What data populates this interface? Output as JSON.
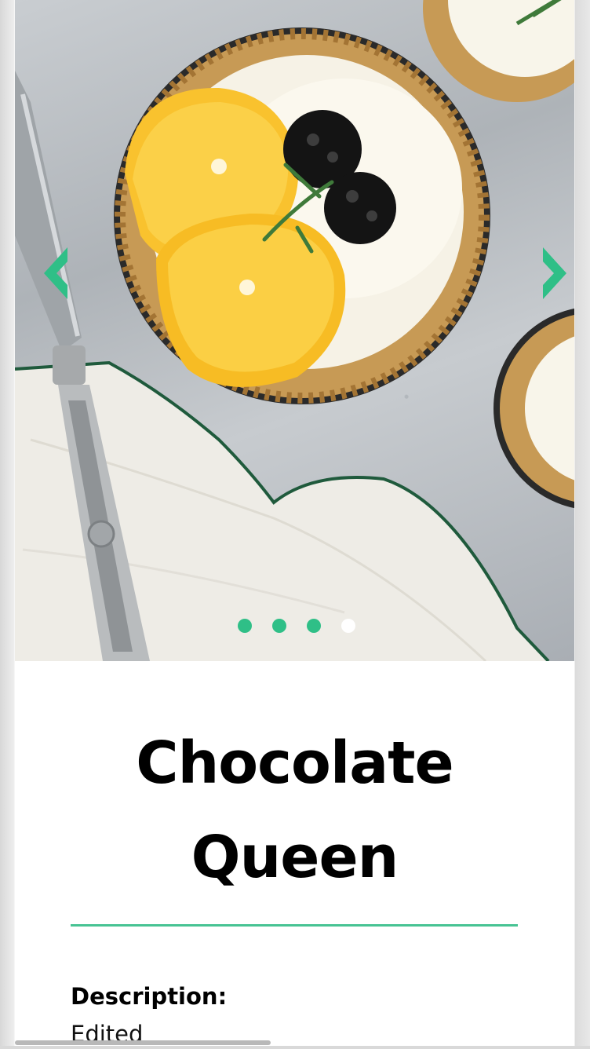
{
  "carousel": {
    "image_alt": "Mini tarts with cream, orange slices and blackberries",
    "slide_count": 4,
    "active_slide": 4,
    "prev_icon": "chevron-left-icon",
    "next_icon": "chevron-right-icon",
    "accent_color": "#2fbf87"
  },
  "recipe": {
    "title_line1": "Chocolate",
    "title_line2": "Queen",
    "description_label": "Description:",
    "description_value": "Edited"
  },
  "colors": {
    "accent": "#2fbf87",
    "divider": "#47c393",
    "text": "#000000"
  }
}
